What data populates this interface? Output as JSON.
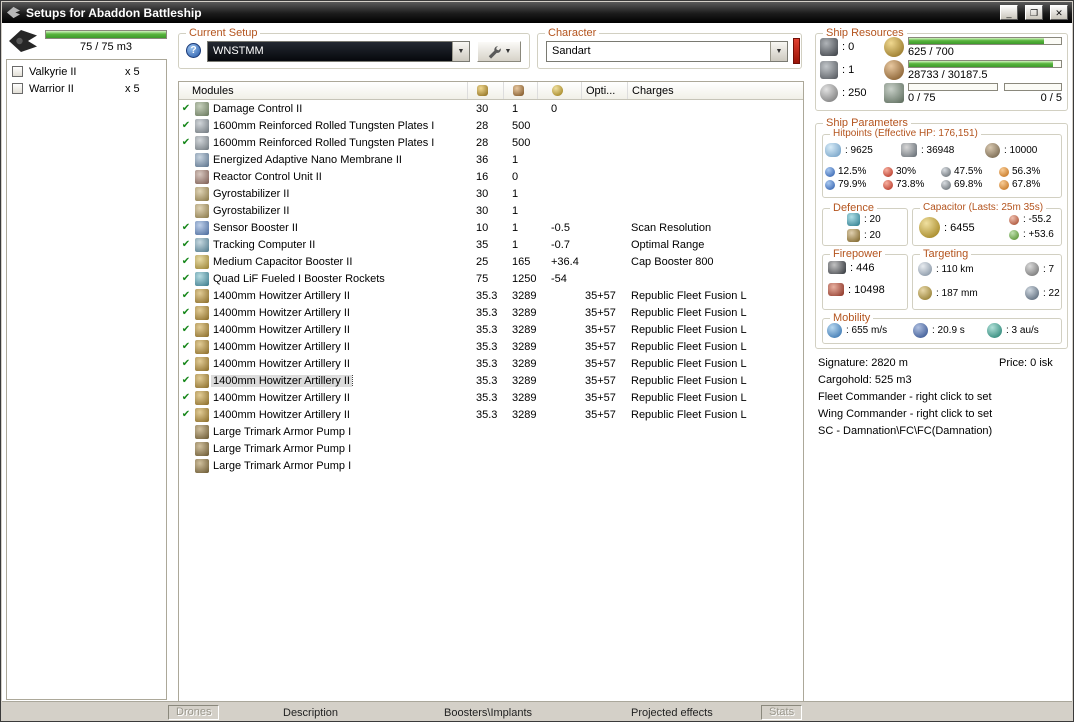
{
  "window": {
    "title": "Setups for Abaddon Battleship"
  },
  "icons": {
    "minimize": "_",
    "maximize": "❐",
    "close": "✕",
    "help": "?",
    "dropdown": "▼",
    "check": "✔"
  },
  "drone_bay": {
    "capacity": "75 / 75 m3",
    "pct": 100,
    "items": [
      {
        "name": "Valkyrie II",
        "qty": "x 5"
      },
      {
        "name": "Warrior II",
        "qty": "x 5"
      }
    ]
  },
  "current_setup": {
    "label": "Current Setup",
    "value": "WNSTMM"
  },
  "character": {
    "label": "Character",
    "value": "Sandart"
  },
  "modules": {
    "header": "Modules",
    "opti_header": "Opti...",
    "charges_header": "Charges",
    "selected_index": 16,
    "rows": [
      {
        "check": true,
        "type": "damage-control",
        "name": "Damage Control II",
        "cpu": "30",
        "pg": "1",
        "cap": "0",
        "opti": "",
        "charge": ""
      },
      {
        "check": true,
        "type": "plate",
        "name": "1600mm Reinforced Rolled Tungsten Plates I",
        "cpu": "28",
        "pg": "500",
        "cap": "",
        "opti": "",
        "charge": ""
      },
      {
        "check": true,
        "type": "plate",
        "name": "1600mm Reinforced Rolled Tungsten Plates I",
        "cpu": "28",
        "pg": "500",
        "cap": "",
        "opti": "",
        "charge": ""
      },
      {
        "check": false,
        "type": "membrane",
        "name": "Energized Adaptive Nano Membrane II",
        "cpu": "36",
        "pg": "1",
        "cap": "",
        "opti": "",
        "charge": ""
      },
      {
        "check": false,
        "type": "rcu",
        "name": "Reactor Control Unit II",
        "cpu": "16",
        "pg": "0",
        "cap": "",
        "opti": "",
        "charge": ""
      },
      {
        "check": false,
        "type": "gyro",
        "name": "Gyrostabilizer II",
        "cpu": "30",
        "pg": "1",
        "cap": "",
        "opti": "",
        "charge": ""
      },
      {
        "check": false,
        "type": "gyro",
        "name": "Gyrostabilizer II",
        "cpu": "30",
        "pg": "1",
        "cap": "",
        "opti": "",
        "charge": ""
      },
      {
        "check": true,
        "type": "sensor-booster",
        "name": "Sensor Booster II",
        "cpu": "10",
        "pg": "1",
        "cap": "-0.5",
        "opti": "",
        "charge": "Scan Resolution"
      },
      {
        "check": true,
        "type": "tracking-computer",
        "name": "Tracking Computer II",
        "cpu": "35",
        "pg": "1",
        "cap": "-0.7",
        "opti": "",
        "charge": "Optimal Range"
      },
      {
        "check": true,
        "type": "cap-booster",
        "name": "Medium Capacitor Booster II",
        "cpu": "25",
        "pg": "165",
        "cap": "+36.4",
        "opti": "",
        "charge": "Cap Booster 800"
      },
      {
        "check": true,
        "type": "afterburner",
        "name": "Quad LiF Fueled I Booster Rockets",
        "cpu": "75",
        "pg": "1250",
        "cap": "-54",
        "opti": "",
        "charge": ""
      },
      {
        "check": true,
        "type": "artillery",
        "name": "1400mm Howitzer Artillery II",
        "cpu": "35.3",
        "pg": "3289",
        "cap": "",
        "opti": "35+57",
        "charge": "Republic Fleet Fusion L"
      },
      {
        "check": true,
        "type": "artillery",
        "name": "1400mm Howitzer Artillery II",
        "cpu": "35.3",
        "pg": "3289",
        "cap": "",
        "opti": "35+57",
        "charge": "Republic Fleet Fusion L"
      },
      {
        "check": true,
        "type": "artillery",
        "name": "1400mm Howitzer Artillery II",
        "cpu": "35.3",
        "pg": "3289",
        "cap": "",
        "opti": "35+57",
        "charge": "Republic Fleet Fusion L"
      },
      {
        "check": true,
        "type": "artillery",
        "name": "1400mm Howitzer Artillery II",
        "cpu": "35.3",
        "pg": "3289",
        "cap": "",
        "opti": "35+57",
        "charge": "Republic Fleet Fusion L"
      },
      {
        "check": true,
        "type": "artillery",
        "name": "1400mm Howitzer Artillery II",
        "cpu": "35.3",
        "pg": "3289",
        "cap": "",
        "opti": "35+57",
        "charge": "Republic Fleet Fusion L"
      },
      {
        "check": true,
        "type": "artillery",
        "name": "1400mm Howitzer Artillery II",
        "cpu": "35.3",
        "pg": "3289",
        "cap": "",
        "opti": "35+57",
        "charge": "Republic Fleet Fusion L"
      },
      {
        "check": true,
        "type": "artillery",
        "name": "1400mm Howitzer Artillery II",
        "cpu": "35.3",
        "pg": "3289",
        "cap": "",
        "opti": "35+57",
        "charge": "Republic Fleet Fusion L"
      },
      {
        "check": true,
        "type": "artillery",
        "name": "1400mm Howitzer Artillery II",
        "cpu": "35.3",
        "pg": "3289",
        "cap": "",
        "opti": "35+57",
        "charge": "Republic Fleet Fusion L"
      },
      {
        "check": false,
        "type": "rig",
        "name": "Large Trimark Armor Pump I",
        "cpu": "",
        "pg": "",
        "cap": "",
        "opti": "",
        "charge": ""
      },
      {
        "check": false,
        "type": "rig",
        "name": "Large Trimark Armor Pump I",
        "cpu": "",
        "pg": "",
        "cap": "",
        "opti": "",
        "charge": ""
      },
      {
        "check": false,
        "type": "rig",
        "name": "Large Trimark Armor Pump I",
        "cpu": "",
        "pg": "",
        "cap": "",
        "opti": "",
        "charge": ""
      }
    ]
  },
  "tabs": {
    "drones": "Drones",
    "description": "Description",
    "boosters": "Boosters\\Implants",
    "projected": "Projected effects",
    "stats": "Stats"
  },
  "ship_resources": {
    "title": "Ship Resources",
    "turrets": ": 0",
    "launchers": ": 1",
    "calibration": ": 250",
    "cpu": "625 / 700",
    "cpu_pct": 89,
    "powergrid": "28733 / 30187.5",
    "powergrid_pct": 95,
    "dronebay": "0 / 75",
    "dronebay_pct": 0,
    "drones_active": "0 / 5",
    "drones_active_pct": 0
  },
  "ship_parameters": {
    "title": "Ship Parameters",
    "hitpoints": {
      "title": "Hitpoints (Effective HP: 176,151)",
      "shield": ": 9625",
      "armor": ": 36948",
      "structure": ": 10000",
      "resists": [
        {
          "type": "em",
          "shield": "12.5%",
          "armor": "79.9%"
        },
        {
          "type": "thermal",
          "shield": "30%",
          "armor": "73.8%"
        },
        {
          "type": "kinetic",
          "shield": "47.5%",
          "armor": "69.8%"
        },
        {
          "type": "explosive",
          "shield": "56.3%",
          "armor": "67.8%"
        }
      ]
    },
    "defence": {
      "title": "Defence",
      "shield_recharge": ": 20",
      "armor_repair": ": 20"
    },
    "capacitor": {
      "title": "Capacitor (Lasts: 25m 35s)",
      "amount": ": 6455",
      "usage": ": -55.2",
      "recharge": ": +53.6"
    },
    "firepower": {
      "title": "Firepower",
      "dps": ": 446",
      "volley": ": 10498"
    },
    "targeting": {
      "title": "Targeting",
      "range": ": 110 km",
      "max_targets": ": 7",
      "scan_resolution": ": 187 mm",
      "sensor_strength": ": 22"
    },
    "mobility": {
      "title": "Mobility",
      "max_velocity": ": 655 m/s",
      "align_time": ": 20.9 s",
      "warp_speed": ": 3 au/s"
    }
  },
  "info": {
    "signature": "Signature: 2820 m",
    "price": "Price: 0 isk",
    "cargohold": "Cargohold: 525 m3",
    "fleet_commander": "Fleet Commander - right click to set",
    "wing_commander": "Wing Commander - right click to set",
    "sc": "SC - Damnation\\FC\\FC(Damnation)"
  },
  "icon_colors": {
    "damage-control": [
      "#c6d0bc",
      "#66765a"
    ],
    "plate": [
      "#d2d6da",
      "#6e767c"
    ],
    "membrane": [
      "#c8d4e0",
      "#58708a"
    ],
    "rcu": [
      "#d8c8c0",
      "#7a5a50"
    ],
    "gyro": [
      "#e0d4b6",
      "#887646"
    ],
    "sensor-booster": [
      "#bed0ea",
      "#48689a"
    ],
    "tracking-computer": [
      "#c6d8e0",
      "#4e788a"
    ],
    "cap-booster": [
      "#e8dca6",
      "#988030"
    ],
    "afterburner": [
      "#b6dce2",
      "#38788a"
    ],
    "artillery": [
      "#e2cc96",
      "#886a26"
    ],
    "rig": [
      "#d0c09e",
      "#685630"
    ],
    "turret-hardpoint": [
      "#b0b4b8",
      "#383c42"
    ],
    "launcher-hardpoint": [
      "#c2c6ca",
      "#50545a"
    ],
    "calibration": [
      "#e2e2e2",
      "#6e6e6e"
    ],
    "cpu": [
      "#f0d890",
      "#886818"
    ],
    "powergrid": [
      "#e8c8a0",
      "#784e1e"
    ],
    "dronebay": [
      "#c8d0c8",
      "#586858"
    ],
    "shield-hp": [
      "#d8ecf8",
      "#6898c0"
    ],
    "armor-hp": [
      "#d8d8d8",
      "#5e666e"
    ],
    "structure-hp": [
      "#d8c8b0",
      "#685840"
    ],
    "em": [
      "#a8c8f0",
      "#2858a8"
    ],
    "thermal": [
      "#f8b0a0",
      "#ae2818"
    ],
    "kinetic": [
      "#d8dce0",
      "#586066"
    ],
    "explosive": [
      "#f8cc96",
      "#be6810"
    ],
    "shield-recharge": [
      "#b0e0e8",
      "#28788a"
    ],
    "armor-repair": [
      "#e0d0b0",
      "#785e20"
    ],
    "capacitor": [
      "#f0e0a0",
      "#987810"
    ],
    "cap-usage": [
      "#f0c0b0",
      "#9e3e20"
    ],
    "cap-recharge": [
      "#c0e0b0",
      "#488820"
    ],
    "turret-dps": [
      "#c2c2c2",
      "#2e3238"
    ],
    "volley": [
      "#e8b0a0",
      "#882e20"
    ],
    "targeting-range": [
      "#e8ecf0",
      "#78889a"
    ],
    "max-targets": [
      "#dadada",
      "#666666"
    ],
    "scan-resolution": [
      "#e8d8a8",
      "#887020"
    ],
    "sensor-strength": [
      "#d0d8e0",
      "#48586a"
    ],
    "max-velocity": [
      "#b8d8f0",
      "#2868a8"
    ],
    "align-time": [
      "#b0c0e0",
      "#284888"
    ],
    "warp-speed": [
      "#b0e0d8",
      "#187868"
    ]
  }
}
